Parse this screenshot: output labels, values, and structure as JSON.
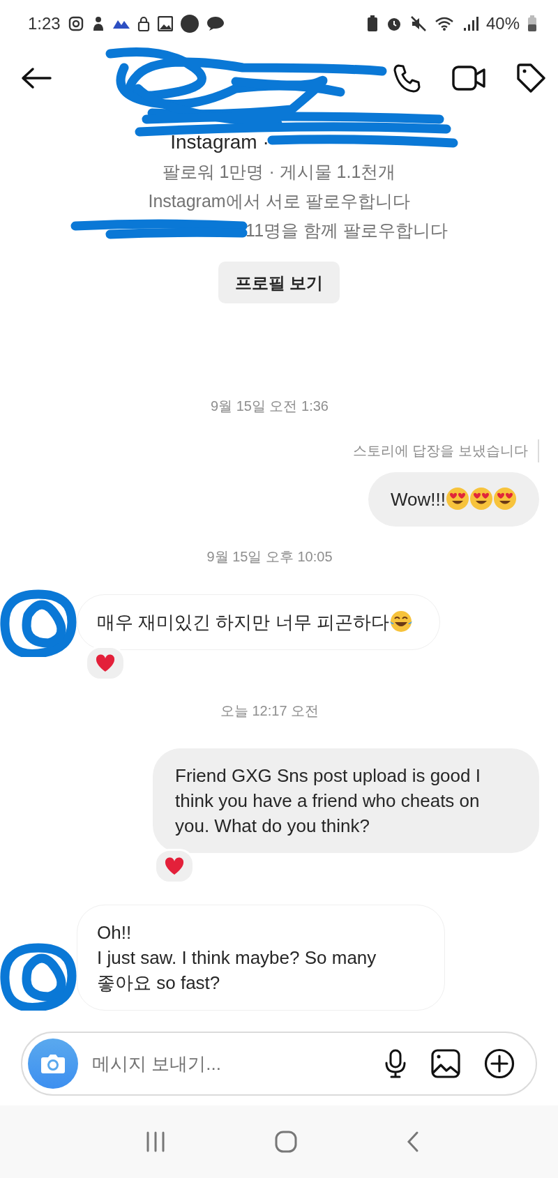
{
  "status_bar": {
    "time": "1:23",
    "battery": "40%"
  },
  "profile": {
    "lines": [
      "Instagram ·",
      "팔로워 1만명 · 게시물 1.1천개",
      "Instagram에서 서로 팔로우합니다",
      "11명을 함께 팔로우합니다"
    ],
    "button": "프로필 보기"
  },
  "messages": [
    {
      "kind": "timestamp",
      "text": "9월 15일 오전 1:36"
    },
    {
      "kind": "note",
      "text": "스토리에 답장을 보냈습니다"
    },
    {
      "kind": "outgoing",
      "text": "Wow!!!",
      "emojis": [
        {
          "kind": "heart-eyes"
        },
        {
          "kind": "heart-eyes"
        },
        {
          "kind": "heart-eyes"
        }
      ]
    },
    {
      "kind": "timestamp",
      "text": "9월 15일 오후 10:05"
    },
    {
      "kind": "incoming",
      "text": "매우 재미있긴 하지만 너무 피곤하다",
      "emojis": [
        {
          "kind": "tears-of-joy"
        }
      ],
      "reaction": {
        "kind": "heart"
      }
    },
    {
      "kind": "timestamp",
      "text": "오늘 12:17 오전"
    },
    {
      "kind": "outgoing",
      "text": "Friend GXG Sns post upload is good I think you have a friend who cheats on you. What do you think?",
      "reaction": {
        "kind": "heart"
      }
    },
    {
      "kind": "incoming",
      "text": "Oh!!\nI just saw. I think maybe? So many 좋아요 so fast?"
    }
  ],
  "composer": {
    "placeholder": "메시지 보내기..."
  }
}
